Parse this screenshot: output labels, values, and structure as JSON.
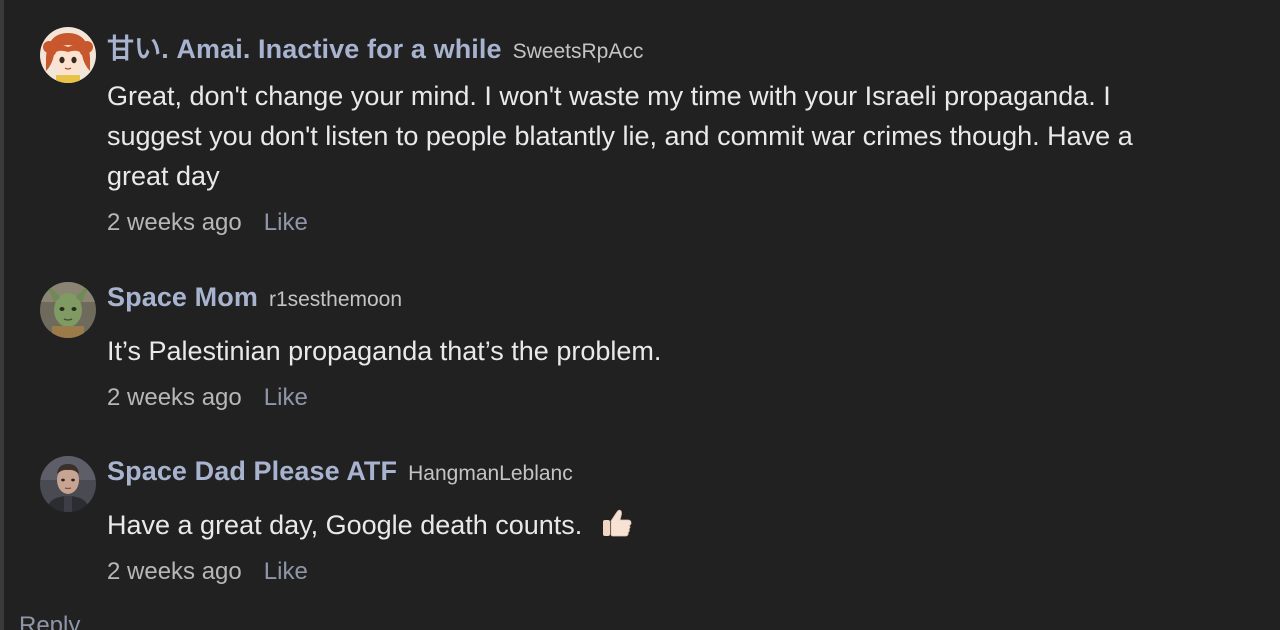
{
  "comments": [
    {
      "display_name": "甘い. Amai. Inactive for a while",
      "username": "SweetsRpAcc",
      "text": "Great, don't change your mind. I won't waste my time with your Israeli propaganda. I suggest you don't listen to people blatantly lie, and commit war crimes though. Have a great day",
      "timestamp": "2 weeks ago",
      "like_label": "Like",
      "avatar_icon": "anime-girl-avatar"
    },
    {
      "display_name": "Space Mom",
      "username": "r1sesthemoon",
      "text": "It’s Palestinian propaganda that’s the problem.",
      "timestamp": "2 weeks ago",
      "like_label": "Like",
      "avatar_icon": "alien-character-avatar"
    },
    {
      "display_name": "Space Dad Please ATF",
      "username": "HangmanLeblanc",
      "text": "Have a great day, Google death counts.",
      "emoji": "thumbs-up-icon",
      "timestamp": "2 weeks ago",
      "like_label": "Like",
      "avatar_icon": "uniformed-man-avatar"
    }
  ],
  "reply_label": "Reply",
  "colors": {
    "background": "#212121",
    "display_name": "#a8b4cf",
    "username": "#c4c4c6",
    "body_text": "#e9e9eb",
    "timestamp": "#b7b7b9",
    "link": "#8e96a8"
  }
}
